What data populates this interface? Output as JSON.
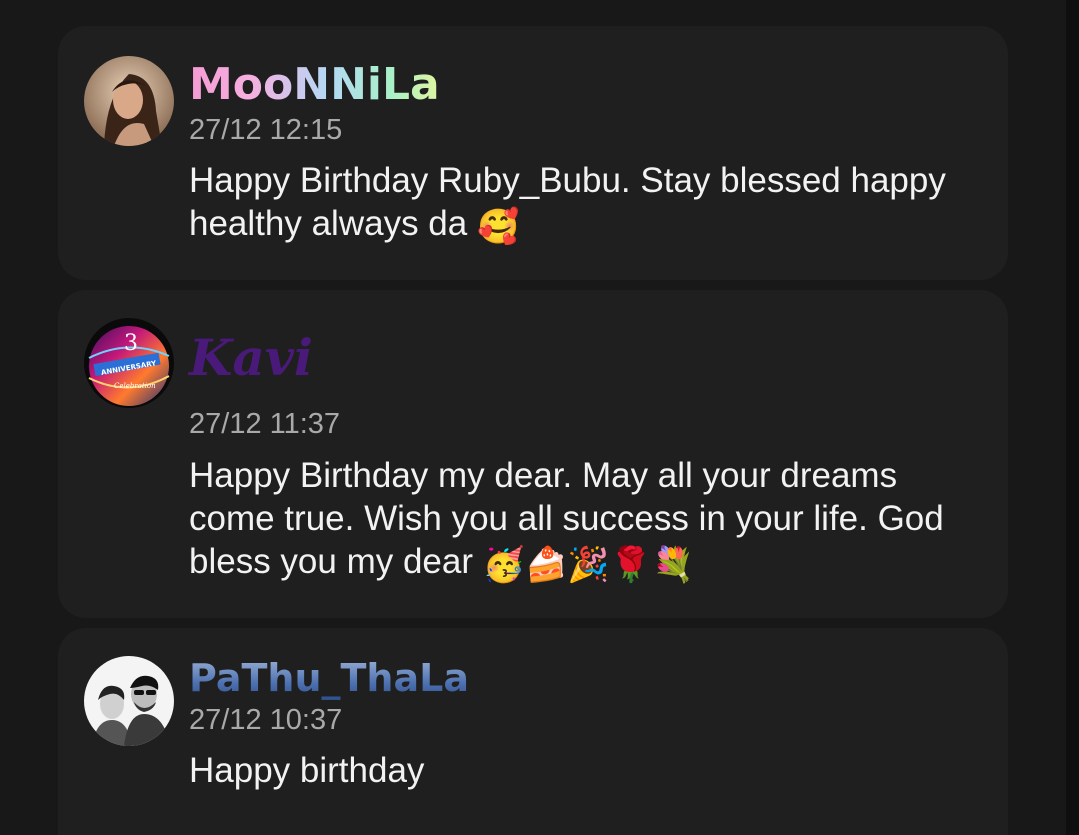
{
  "comments": [
    {
      "username": "MooNNiLa",
      "timestamp": "27/12 12:15",
      "message": "Happy Birthday Ruby_Bubu. Stay blessed happy healthy always da",
      "emojis": "🥰",
      "avatar": "woman-portrait"
    },
    {
      "username": "Kavi",
      "timestamp": "27/12 11:37",
      "message": "Happy Birthday my dear. May all your dreams come true. Wish you all success in your life. God bless you my dear",
      "emojis": "🥳🍰🎉🌹💐",
      "avatar": "3-anniversary-celebration-badge",
      "avatar_text": {
        "number": "3",
        "ribbon": "ANNIVERSARY",
        "script": "Celebration"
      }
    },
    {
      "username": "PaThu_ThaLa",
      "timestamp": "27/12 10:37",
      "message": "Happy birthday",
      "avatar": "two-men-sketch"
    }
  ],
  "colors": {
    "background": "#181818",
    "card": "#1f1f1f",
    "timestamp": "#a9a9a9",
    "message": "#f2f2f2",
    "kavi_name": "#4a1a7a"
  }
}
